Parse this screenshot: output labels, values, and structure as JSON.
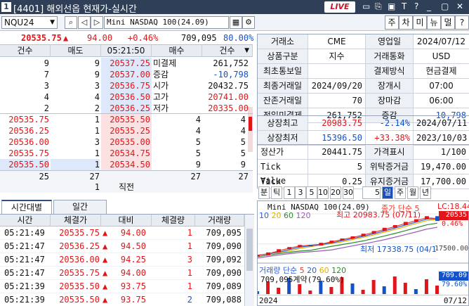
{
  "window": {
    "num": "1",
    "title": "[4401] 해외선옵 현재가-실시간",
    "live": "LIVE",
    "controls": [
      "▭",
      "⎘",
      "▣",
      "T",
      "?",
      "_",
      "▢",
      "✕"
    ]
  },
  "toolbar": {
    "code": "NQU24",
    "name": "Mini NASDAQ 100(24.09)",
    "right_buttons": [
      "주",
      "차",
      "미",
      "뉴",
      "멀",
      "?"
    ]
  },
  "summary": {
    "price": "20535.75",
    "arrow": "▲",
    "change": "94.00",
    "pct": "+0.46%",
    "volume": "709,095",
    "ratio": "80.00%"
  },
  "orderbook": {
    "headers": [
      "건수",
      "매도",
      "05:21:50",
      "매수",
      "건수"
    ],
    "asks": [
      {
        "count": "9",
        "qty": "9",
        "price": "20537.25",
        "label": "미결제",
        "value": "261,752"
      },
      {
        "count": "7",
        "qty": "9",
        "price": "20537.00",
        "label": "증감",
        "value": "-10,798"
      },
      {
        "count": "3",
        "qty": "3",
        "price": "20536.75",
        "label": "시가",
        "value": "20432.75"
      },
      {
        "count": "4",
        "qty": "4",
        "price": "20536.50",
        "label": "고가",
        "value": "20741.00"
      },
      {
        "count": "2",
        "qty": "2",
        "price": "20536.25",
        "label": "저가",
        "value": "20335.00"
      }
    ],
    "bids": [
      {
        "left": "20535.75",
        "qty": "1",
        "price": "20535.50",
        "bqty": "4",
        "bcount": "4"
      },
      {
        "left": "20536.25",
        "qty": "1",
        "price": "20535.25",
        "bqty": "4",
        "bcount": "4"
      },
      {
        "left": "20536.00",
        "qty": "3",
        "price": "20535.00",
        "bqty": "5",
        "bcount": "5"
      },
      {
        "left": "20535.75",
        "qty": "1",
        "price": "20534.75",
        "bqty": "5",
        "bcount": "5"
      },
      {
        "left": "20535.50",
        "qty": "1",
        "price": "20534.50",
        "bqty": "9",
        "bcount": "9"
      }
    ],
    "totals": {
      "ask_count": "25",
      "ask_qty": "27",
      "bid_qty": "27",
      "bid_count": "27"
    },
    "extra": {
      "qty": "1",
      "label": "직전"
    }
  },
  "info": {
    "rows1": [
      [
        "거래소",
        "CME",
        "영업일",
        "2024/07/12"
      ],
      [
        "상품구분",
        "지수",
        "거래통화",
        "USD"
      ],
      [
        "최초통보일",
        "",
        "결제방식",
        "현금결제"
      ],
      [
        "최종거래일",
        "2024/09/20",
        "장개시",
        "07:00"
      ],
      [
        "잔존거래일",
        "70",
        "장마감",
        "06:00"
      ],
      [
        "전일미결제",
        "261,752",
        "증감",
        "-10,798"
      ]
    ],
    "rows2": [
      [
        "상장최고",
        "20983.75",
        "-2.14%",
        "2024/07/11"
      ],
      [
        "상장최저",
        "15396.50",
        "+33.38%",
        "2023/10/03"
      ]
    ],
    "rows3": [
      [
        "정산가",
        "20441.75",
        "가격표시",
        "1/100"
      ],
      [
        "Tick Value",
        "5",
        "위탁증거금",
        "19,470.00"
      ],
      [
        "Tick Size",
        "0.25",
        "유지증거금",
        "17,700.00"
      ]
    ]
  },
  "chart_controls": [
    "분",
    "틱",
    "1",
    "3",
    "5",
    "10",
    "20",
    "30",
    "5",
    "일",
    "주",
    "월",
    "년"
  ],
  "chart": {
    "title": "Mini NASDAQ 100(24.09)",
    "legend_extra": "종가 단순 5",
    "ma": [
      "10",
      "20",
      "60",
      "120"
    ],
    "high_label": "최고 20983.75 (07/11)",
    "low_label": "최저 17338.75 (04/1",
    "lc": "LC:18.44",
    "last_price": "20535",
    "last_pct": "0.46%",
    "y_tick": "17500.00",
    "vol_title": "거래량 단순",
    "vol_ma": [
      "5",
      "20",
      "60",
      "120"
    ],
    "vol_text": "709,095계약(79.60%)",
    "vol_price": "709.09",
    "vol_pct": "79.60%",
    "year": "2024",
    "date_right": "07/12",
    "colors": {
      "ma5": "#e63a2f",
      "ma10": "#2f5fd0",
      "ma20": "#e0b000",
      "ma60": "#2a8a2a",
      "ma120": "#9b59b6"
    }
  },
  "chart_data": {
    "type": "line",
    "title": "Mini NASDAQ 100(24.09)",
    "series": [
      {
        "name": "Mini NASDAQ 100(24.09)",
        "values": [
          17340,
          17600,
          17900,
          18100,
          18300,
          18250,
          18500,
          18700,
          18900,
          19100,
          19350,
          19600,
          19900,
          20150,
          20450,
          20700,
          20983,
          20535
        ]
      }
    ],
    "ylim": [
      17000,
      21200
    ]
  },
  "tabs": [
    "시간대별",
    "일간"
  ],
  "trades": {
    "headers": [
      "시간",
      "체결가",
      "대비",
      "체결량",
      "거래량"
    ],
    "rows": [
      {
        "time": "05:21:49",
        "price": "20535.75",
        "diff": "94.00",
        "qty": "1",
        "vol": "709,095",
        "dir": "up"
      },
      {
        "time": "05:21:47",
        "price": "20536.25",
        "diff": "94.50",
        "qty": "1",
        "vol": "709,090",
        "dir": "up"
      },
      {
        "time": "05:21:47",
        "price": "20536.00",
        "diff": "94.25",
        "qty": "3",
        "vol": "709,092",
        "dir": "up"
      },
      {
        "time": "05:21:47",
        "price": "20535.75",
        "diff": "94.00",
        "qty": "1",
        "vol": "709,090",
        "dir": "up"
      },
      {
        "time": "05:21:39",
        "price": "20535.50",
        "diff": "93.75",
        "qty": "1",
        "vol": "709,089",
        "dir": "up"
      },
      {
        "time": "05:21:39",
        "price": "20535.50",
        "diff": "93.75",
        "qty": "2",
        "vol": "709,088",
        "dir": "dn"
      }
    ]
  }
}
